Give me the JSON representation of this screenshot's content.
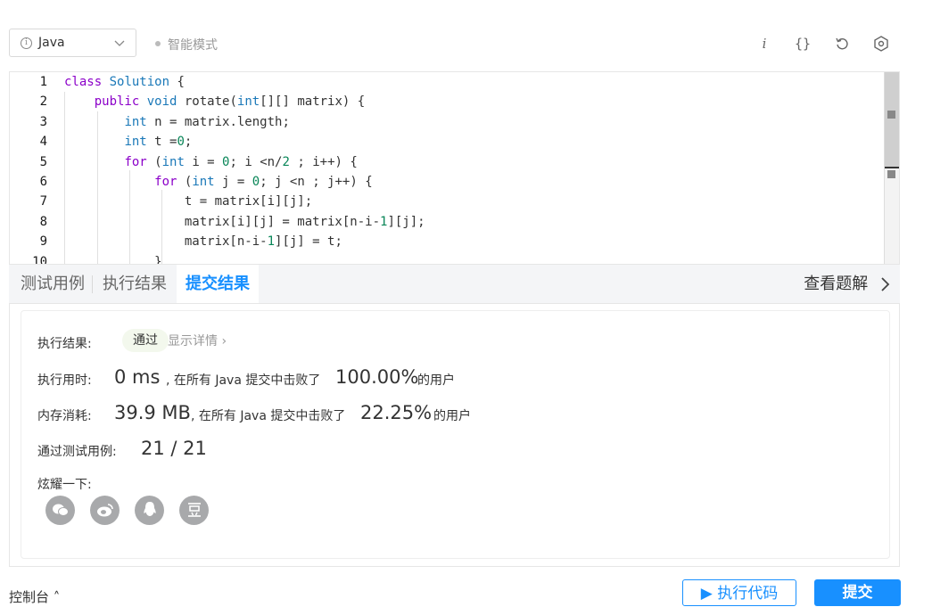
{
  "toolbar": {
    "language": "Java",
    "mode_label": "智能模式",
    "icons": [
      "info-icon",
      "braces-icon",
      "reset-icon",
      "settings-icon"
    ]
  },
  "editor": {
    "lines": [
      {
        "num": "1",
        "parts": [
          [
            "kw",
            "class"
          ],
          [
            "t",
            " "
          ],
          [
            "cls",
            "Solution"
          ],
          [
            "t",
            " {"
          ]
        ]
      },
      {
        "num": "2",
        "parts": [
          [
            "t",
            "    "
          ],
          [
            "kw",
            "public"
          ],
          [
            "t",
            " "
          ],
          [
            "ty",
            "void"
          ],
          [
            "t",
            " rotate("
          ],
          [
            "ty",
            "int"
          ],
          [
            "t",
            "[][] matrix) {"
          ]
        ]
      },
      {
        "num": "3",
        "parts": [
          [
            "t",
            "        "
          ],
          [
            "ty",
            "int"
          ],
          [
            "t",
            " n = matrix.length;"
          ]
        ]
      },
      {
        "num": "4",
        "parts": [
          [
            "t",
            "        "
          ],
          [
            "ty",
            "int"
          ],
          [
            "t",
            " t ="
          ],
          [
            "num",
            "0"
          ],
          [
            "t",
            ";"
          ]
        ]
      },
      {
        "num": "5",
        "parts": [
          [
            "t",
            "        "
          ],
          [
            "kw",
            "for"
          ],
          [
            "t",
            " ("
          ],
          [
            "ty",
            "int"
          ],
          [
            "t",
            " i = "
          ],
          [
            "num",
            "0"
          ],
          [
            "t",
            "; i <n/"
          ],
          [
            "num",
            "2"
          ],
          [
            "t",
            " ; i++) {"
          ]
        ]
      },
      {
        "num": "6",
        "parts": [
          [
            "t",
            "            "
          ],
          [
            "kw",
            "for"
          ],
          [
            "t",
            " ("
          ],
          [
            "ty",
            "int"
          ],
          [
            "t",
            " j = "
          ],
          [
            "num",
            "0"
          ],
          [
            "t",
            "; j <n ; j++) {"
          ]
        ]
      },
      {
        "num": "7",
        "parts": [
          [
            "t",
            "                t = matrix[i][j];"
          ]
        ]
      },
      {
        "num": "8",
        "parts": [
          [
            "t",
            "                matrix[i][j] = matrix[n-i-"
          ],
          [
            "num",
            "1"
          ],
          [
            "t",
            "][j];"
          ]
        ]
      },
      {
        "num": "9",
        "parts": [
          [
            "t",
            "                matrix[n-i-"
          ],
          [
            "num",
            "1"
          ],
          [
            "t",
            "][j] = t;"
          ]
        ]
      },
      {
        "num": "10",
        "parts": [
          [
            "t",
            "            }"
          ]
        ]
      }
    ]
  },
  "tabs": [
    "测试用例",
    "执行结果",
    "提交结果"
  ],
  "solutions_label": "查看题解",
  "result": {
    "status_label": "执行结果:",
    "status_badge": "通过",
    "detail_link": "显示详情",
    "runtime_label": "执行用时:",
    "runtime_value": "0 ms",
    "runtime_text": ", 在所有 Java 提交中击败了",
    "runtime_pct": "100.00%",
    "runtime_suffix": "的用户",
    "memory_label": "内存消耗:",
    "memory_value": "39.9 MB",
    "memory_text": ", 在所有 Java 提交中击败了",
    "memory_pct": "22.25%",
    "memory_suffix": "的用户",
    "cases_label": "通过测试用例:",
    "cases_value": "21 / 21",
    "share_label": "炫耀一下:",
    "share_icons": [
      "wechat-icon",
      "weibo-icon",
      "qq-icon",
      "douban-icon"
    ]
  },
  "footer": {
    "console_label": "控制台",
    "run_label": "执行代码",
    "submit_label": "提交"
  },
  "colors": {
    "accent": "#1890ff",
    "pass_badge_bg": "#f3f8ed",
    "keyword": "#8b00c9",
    "type": "#1a78b8",
    "number": "#098658"
  }
}
